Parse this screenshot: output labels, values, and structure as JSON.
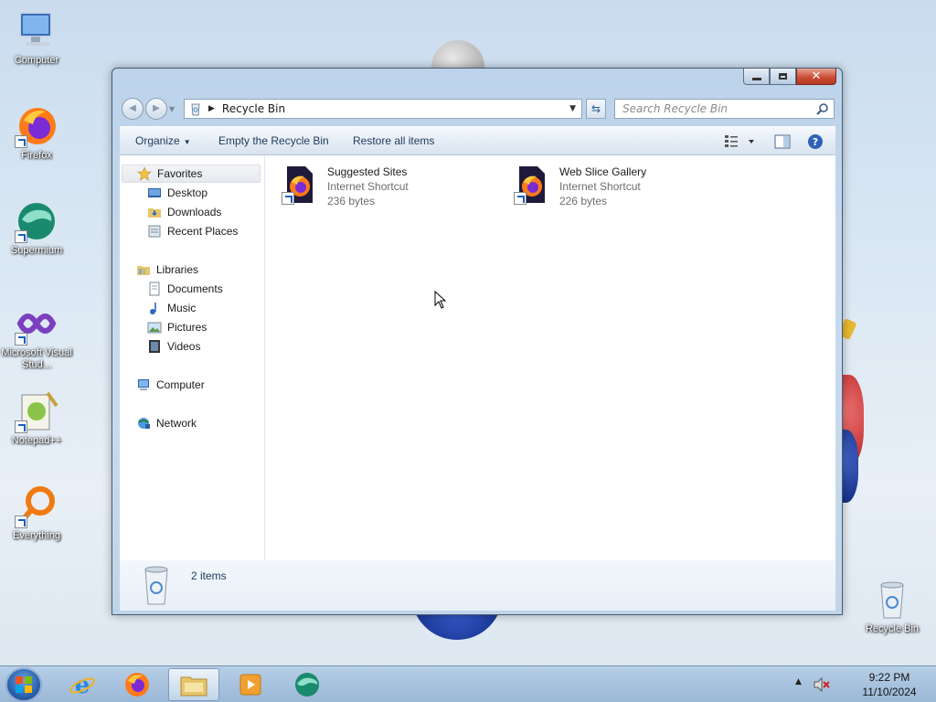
{
  "desktop": {
    "icons": [
      {
        "label": "Computer",
        "icon": "computer-icon"
      },
      {
        "label": "Firefox",
        "icon": "firefox-icon"
      },
      {
        "label": "Supermium",
        "icon": "supermium-icon"
      },
      {
        "label": "Microsoft Visual Stud...",
        "icon": "visual-studio-icon"
      },
      {
        "label": "Notepad++",
        "icon": "notepadpp-icon"
      },
      {
        "label": "Everything",
        "icon": "everything-icon"
      },
      {
        "label": "Recycle Bin",
        "icon": "recycle-bin-icon"
      }
    ]
  },
  "window": {
    "title": "Recycle Bin",
    "address": {
      "crumb": "Recycle Bin"
    },
    "search": {
      "placeholder": "Search Recycle Bin"
    },
    "toolbar": {
      "organize": "Organize",
      "empty": "Empty the Recycle Bin",
      "restore": "Restore all items"
    },
    "nav": {
      "favorites": "Favorites",
      "desktop": "Desktop",
      "downloads": "Downloads",
      "recent": "Recent Places",
      "libraries": "Libraries",
      "documents": "Documents",
      "music": "Music",
      "pictures": "Pictures",
      "videos": "Videos",
      "computer": "Computer",
      "network": "Network"
    },
    "files": [
      {
        "name": "Suggested Sites",
        "type": "Internet Shortcut",
        "size": "236 bytes"
      },
      {
        "name": "Web Slice Gallery",
        "type": "Internet Shortcut",
        "size": "226 bytes"
      }
    ],
    "details": {
      "count": "2 items"
    }
  },
  "taskbar": {
    "time": "9:22 PM",
    "date": "11/10/2024",
    "pinned": [
      "internet-explorer-icon",
      "firefox-icon",
      "explorer-icon",
      "media-player-icon",
      "supermium-icon"
    ]
  },
  "colors": {
    "accent": "#1e395b",
    "close_button": "#c74a32",
    "window_frame": "#bcd3ea"
  }
}
